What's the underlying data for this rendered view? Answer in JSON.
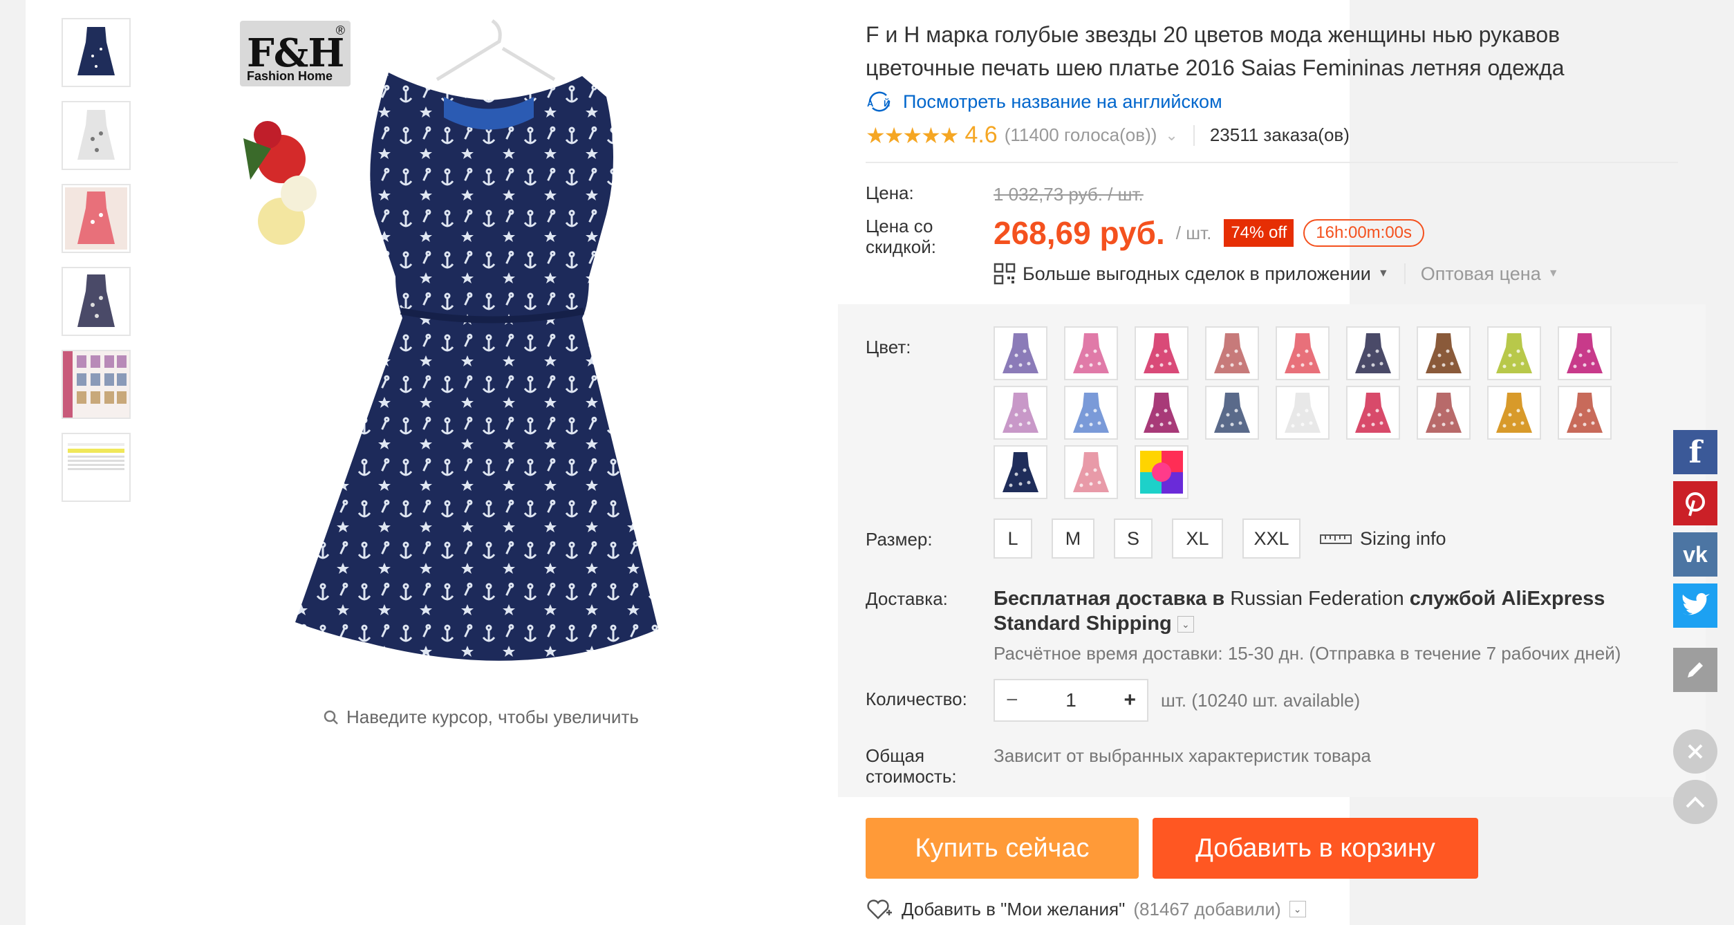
{
  "product": {
    "title": "F и H марка голубые звезды 20 цветов мода женщины нью рукавов цветочные печать шею платье 2016 Saias Femininas летняя одежда",
    "translate_link": "Посмотреть название на английском",
    "rating": "4.6",
    "votes": "(11400 голоса(ов))",
    "orders": "23511 заказа(ов)"
  },
  "brand": {
    "logo": "F&H",
    "sub": "Fashion Home",
    "reg": "®"
  },
  "gallery": {
    "zoom_hint": "Наведите курсор, чтобы увеличить",
    "thumbnail_count": 6
  },
  "price": {
    "label": "Цена:",
    "old": "1 032,73 руб. / шт.",
    "discount_label_1": "Цена со",
    "discount_label_2": "скидкой:",
    "current": "268,69 руб.",
    "unit": "/ шт.",
    "off_badge": "74% off",
    "timer": "16h:00m:00s",
    "app_deals": "Больше выгодных сделок в приложении",
    "wholesale": "Оптовая цена"
  },
  "options": {
    "color_label": "Цвет:",
    "colors": [
      "#8b7bb8",
      "#e07aa8",
      "#d94a78",
      "#c77a7a",
      "#e8707a",
      "#4a4a68",
      "#8a5a3a",
      "#b8c84a",
      "#c83a8a",
      "#c898c8",
      "#7a9ad8",
      "#a83a78",
      "#5a6a8a",
      "#e8e8e8",
      "#d84a6a",
      "#b86a6a",
      "#d89a2a",
      "#c86a5a",
      "#1f2d5a",
      "#e89aa8"
    ],
    "multicolor_swatch": true,
    "size_label": "Размер:",
    "sizes": [
      "L",
      "M",
      "S",
      "XL",
      "XXL"
    ],
    "sizing_info": "Sizing info"
  },
  "shipping": {
    "label": "Доставка:",
    "line_bold_1": "Бесплатная доставка в ",
    "country": "Russian Federation",
    "line_bold_2": " службой AliExpress Standard Shipping",
    "eta": "Расчётное время доставки: 15-30 дн. (Отправка в течение 7 рабочих дней)"
  },
  "quantity": {
    "label": "Количество:",
    "value": "1",
    "minus": "−",
    "plus": "+",
    "info": "шт. (10240 шт. available)"
  },
  "total": {
    "label_1": "Общая",
    "label_2": "стоимость:",
    "value": "Зависит от выбранных характеристик товара"
  },
  "actions": {
    "buy_now": "Купить сейчас",
    "add_to_cart": "Добавить в корзину",
    "wishlist": "Добавить в \"Мои желания\"",
    "wishlist_count": "(81467 добавили)"
  },
  "social": {
    "facebook": "f",
    "vk": "vk"
  },
  "colors": {
    "accent": "#f4511e",
    "buy": "#ff9a38",
    "cart": "#ff5722",
    "link": "#0066cc",
    "facebook": "#3b5998",
    "pinterest": "#cb2027",
    "vk": "#4c75a3",
    "twitter": "#1da1f2"
  }
}
